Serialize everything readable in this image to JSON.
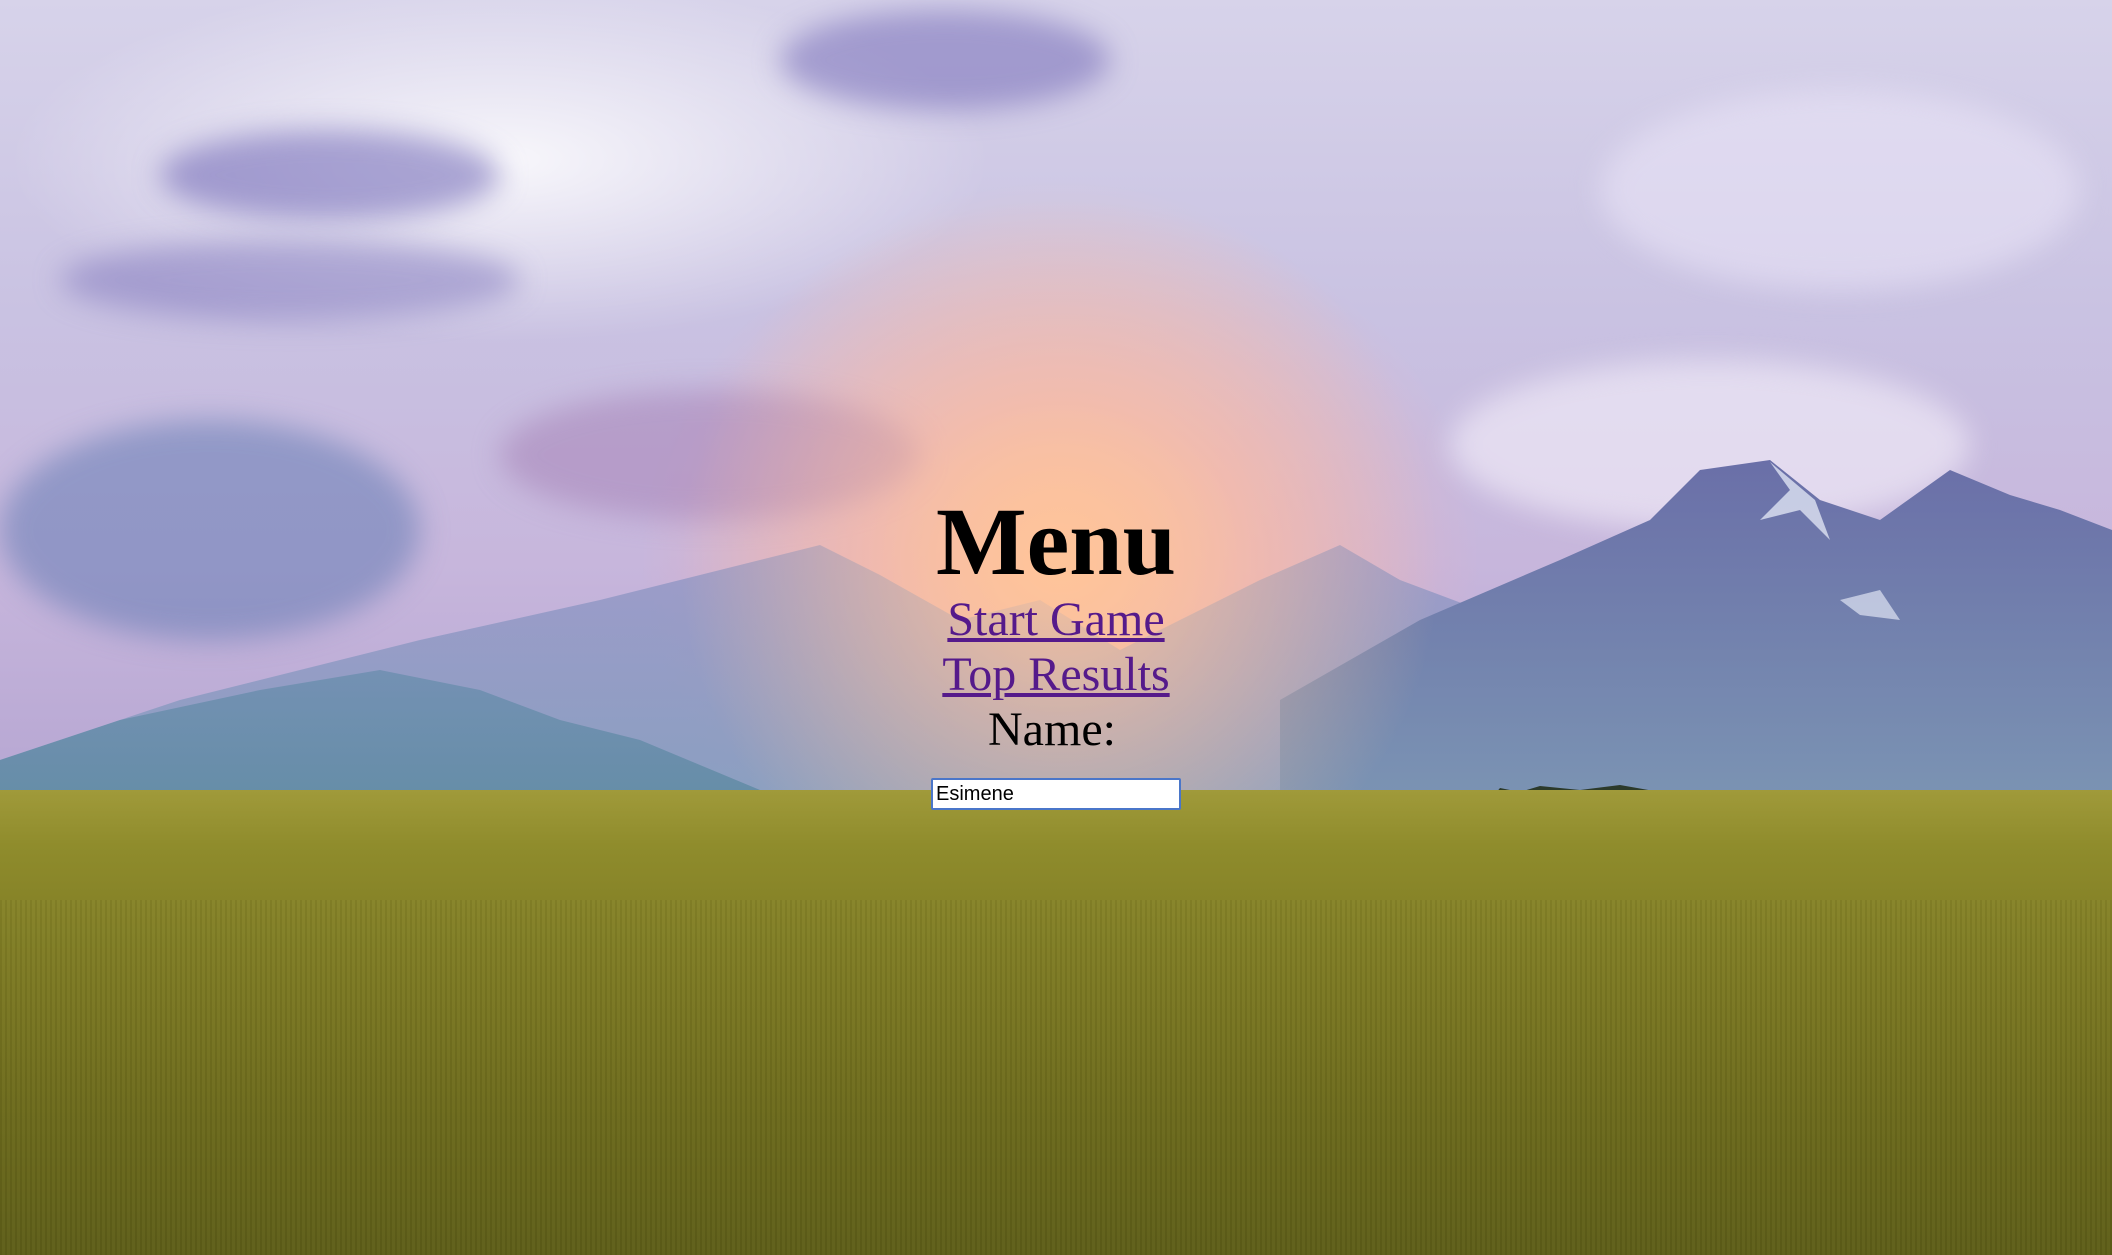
{
  "menu": {
    "title": "Menu",
    "start_game_label": "Start Game",
    "top_results_label": "Top Results",
    "name_label": "Name:",
    "name_value": "Esimene"
  },
  "colors": {
    "title": "#000000",
    "link_visited": "#551a8b",
    "input_focus_border": "#4a76c9"
  }
}
